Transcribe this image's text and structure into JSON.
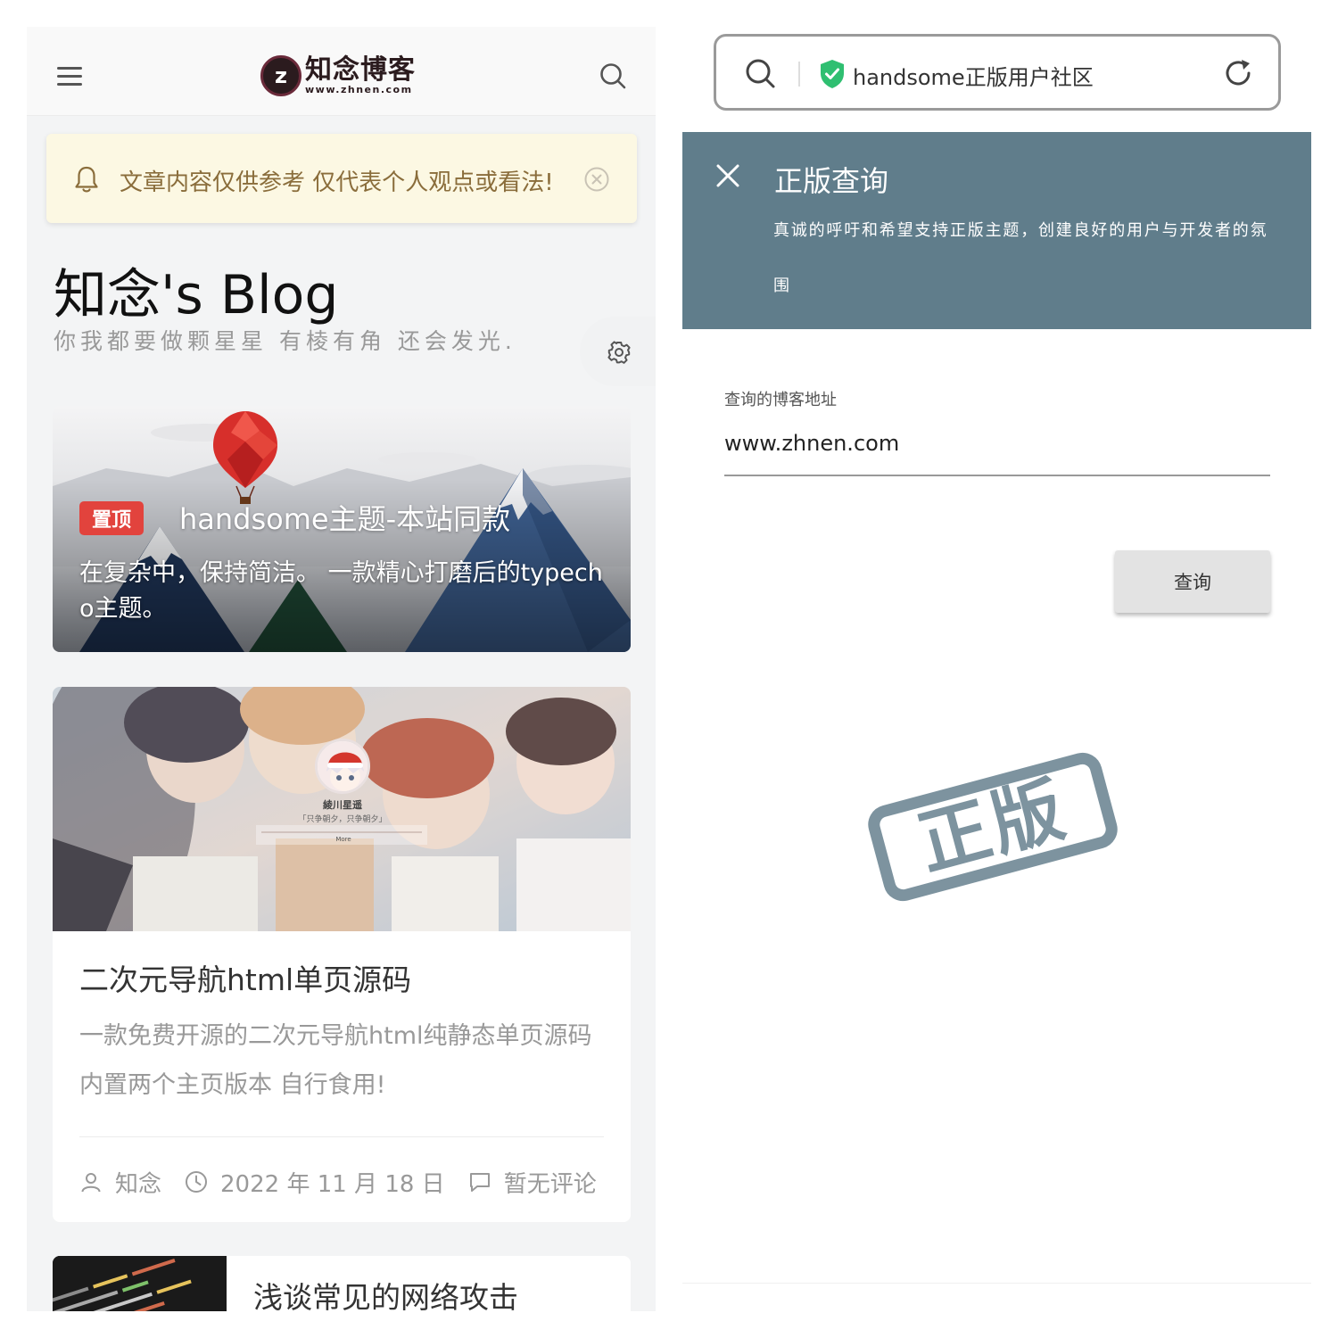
{
  "left": {
    "logo": {
      "mark": "z",
      "name": "知念博客",
      "domain": "www.zhnen.com"
    },
    "notice": {
      "text": "文章内容仅供参考 仅代表个人观点或看法!"
    },
    "blog": {
      "title": "知念's Blog",
      "subtitle": "你我都要做颗星星 有棱有角 还会发光."
    },
    "posts": [
      {
        "badge": "置顶",
        "title": "handsome主题-本站同款",
        "desc": "在复杂中，保持简洁。 一款精心打磨后的typecho主题。"
      },
      {
        "title": "二次元导航html单页源码",
        "desc": "一款免费开源的二次元导航html纯静态单页源码 内置两个主页版本 自行食用!",
        "author": "知念",
        "date": "2022 年 11 月 18 日",
        "comments": "暂无评论",
        "cover": {
          "name": "綾川星遥",
          "motto": "「只争朝夕，只争朝夕」",
          "more": "More"
        }
      },
      {
        "title": "浅谈常见的网络攻击"
      }
    ]
  },
  "right": {
    "address_bar": {
      "url": "handsome正版用户社区"
    },
    "dialog": {
      "title": "正版查询",
      "text": "真诚的呼吁和希望支持正版主题，创建良好的用户与开发者的氛围"
    },
    "form": {
      "label": "查询的博客地址",
      "value": "www.zhnen.com",
      "button": "查询"
    },
    "stamp": "正版"
  },
  "colors": {
    "dialog_header": "#607d8b",
    "notice_bg": "#fcf8e3",
    "notice_text": "#8a6d3b",
    "badge": "#e2433d",
    "verified_green": "#2fbf71",
    "stamp": "#7d939f"
  },
  "icons": [
    "menu-icon",
    "search-icon",
    "bell-icon",
    "close-circle-icon",
    "gear-icon",
    "user-icon",
    "clock-icon",
    "comment-icon",
    "shield-check-icon",
    "reload-icon",
    "close-icon"
  ]
}
